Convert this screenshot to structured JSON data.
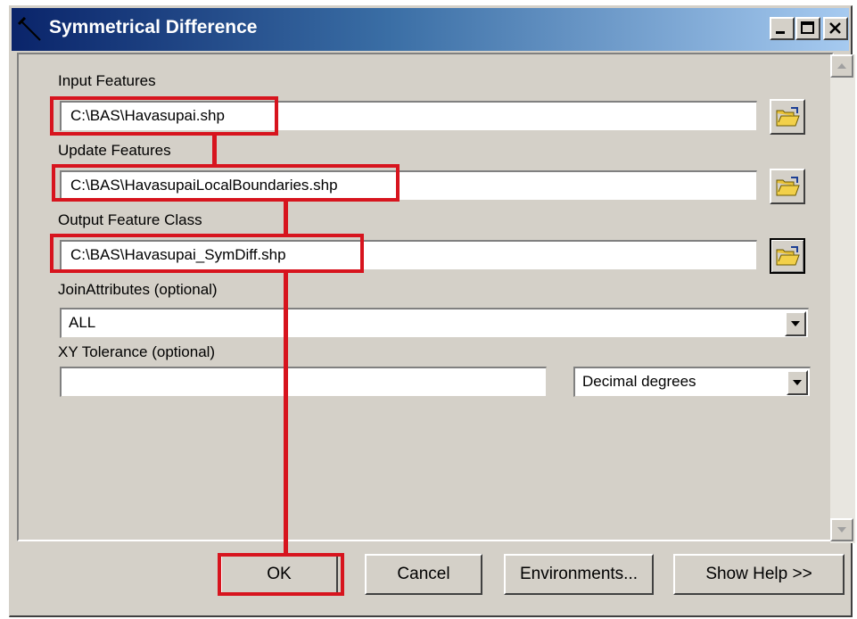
{
  "window": {
    "title": "Symmetrical Difference"
  },
  "fields": {
    "input_features": {
      "label": "Input Features",
      "value": "C:\\BAS\\Havasupai.shp"
    },
    "update_features": {
      "label": "Update Features",
      "value": "C:\\BAS\\HavasupaiLocalBoundaries.shp"
    },
    "output_feature_class": {
      "label": "Output Feature Class",
      "value": "C:\\BAS\\Havasupai_SymDiff.shp"
    },
    "join_attributes": {
      "label": "JoinAttributes (optional)",
      "value": "ALL"
    },
    "xy_tolerance": {
      "label": "XY Tolerance (optional)",
      "value": "",
      "units": "Decimal degrees"
    }
  },
  "buttons": {
    "ok": "OK",
    "cancel": "Cancel",
    "environments": "Environments...",
    "help": "Show Help >>"
  },
  "icons": {
    "title": "hammer-icon",
    "browse": "folder-open-icon"
  },
  "colors": {
    "highlight": "#d7141e",
    "titlebar": "#0a246a"
  }
}
